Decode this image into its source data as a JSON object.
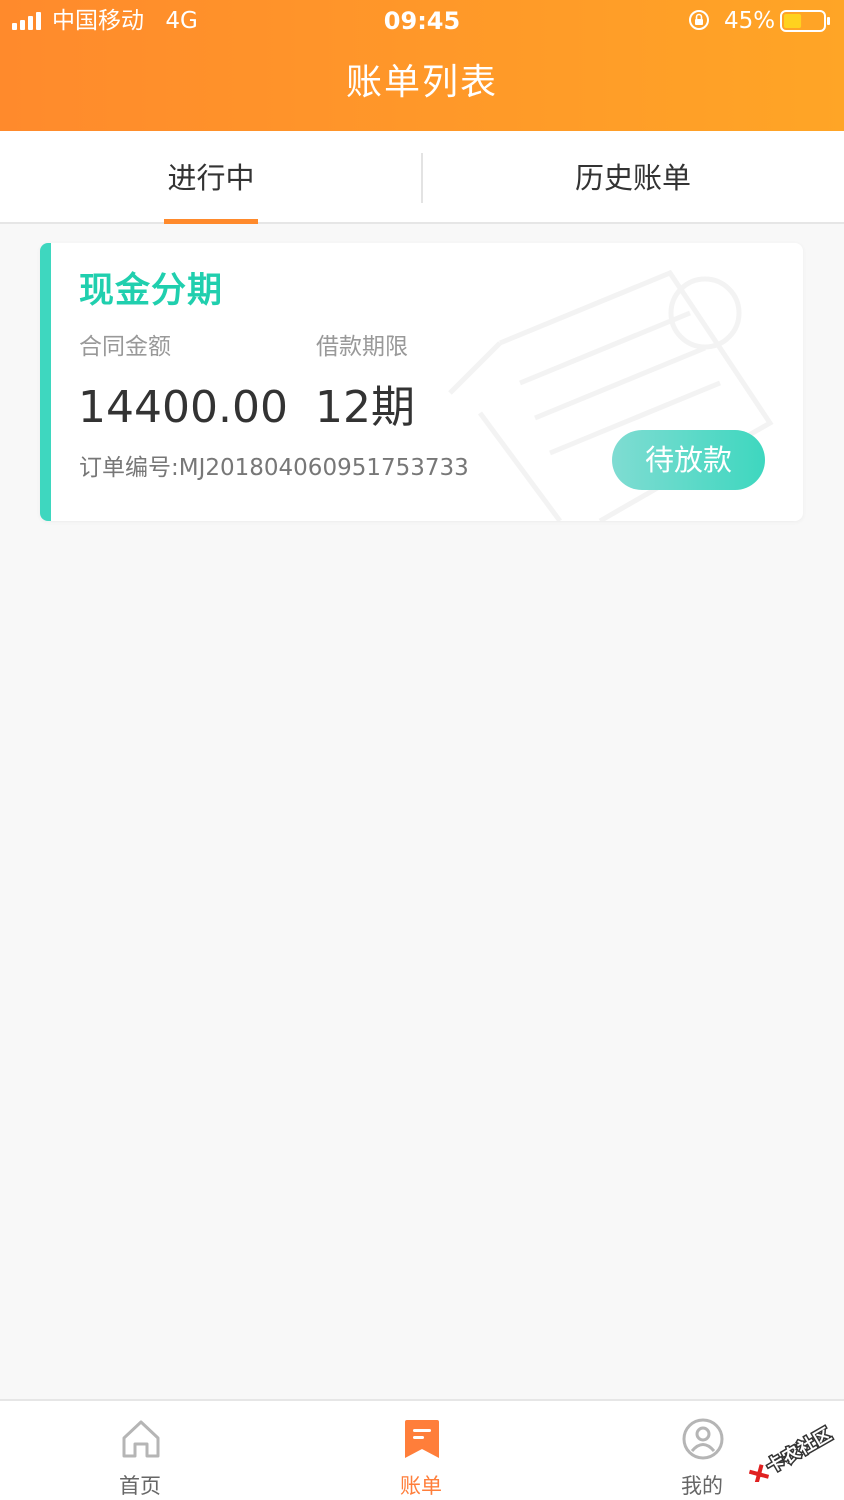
{
  "status_bar": {
    "carrier": "中国移动",
    "network": "4G",
    "time": "09:45",
    "battery_percent": "45%",
    "battery_level": 0.45,
    "icons": [
      "signal-icon",
      "orientation-lock-icon",
      "battery-icon"
    ]
  },
  "header": {
    "title": "账单列表"
  },
  "tabs": [
    {
      "label": "进行中",
      "active": true
    },
    {
      "label": "历史账单",
      "active": false
    }
  ],
  "bill_card": {
    "product_name": "现金分期",
    "amount_label": "合同金额",
    "term_label": "借款期限",
    "amount_value": "14400.00",
    "term_value": "12期",
    "order_prefix": "订单编号:",
    "order_number": "MJ201804060951753733",
    "status_button": "待放款",
    "watermark_icon": "bill-watermark-icon"
  },
  "bottom_nav": [
    {
      "label": "首页",
      "icon": "home-icon",
      "active": false
    },
    {
      "label": "账单",
      "icon": "bill-icon",
      "active": true
    },
    {
      "label": "我的",
      "icon": "profile-icon",
      "active": false
    }
  ],
  "watermark": {
    "text": "卡农社区",
    "icon": "community-logo-icon"
  },
  "colors": {
    "header_gradient_start": "#ff8a2c",
    "header_gradient_end": "#ffa526",
    "accent_orange": "#ff8a2c",
    "teal": "#3ed7bf",
    "title_teal": "#20cfae",
    "background": "#f8f8f8"
  }
}
